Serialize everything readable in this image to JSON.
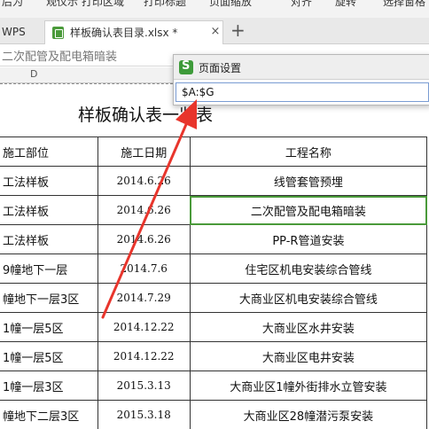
{
  "toolbar": {
    "items": [
      "后为",
      "观仪示",
      "打印区域",
      "打印标题",
      "页面缩放",
      "对齐",
      "旋转",
      "选择窗格"
    ]
  },
  "tabs": {
    "app_tab": "WPS",
    "file_tab": "样板确认表目录.xlsx *",
    "close_glyph": "×",
    "add_glyph": "+"
  },
  "editbar": {
    "content": "二次配管及配电箱暗装"
  },
  "column_header": {
    "visible_column": "D"
  },
  "sheet": {
    "title": "样板确认表一览表",
    "headers": [
      "施工部位",
      "施工日期",
      "工程名称"
    ],
    "rows": [
      [
        "工法样板",
        "2014.6.26",
        "线管套管预埋"
      ],
      [
        "工法样板",
        "2014.6.26",
        "二次配管及配电箱暗装"
      ],
      [
        "工法样板",
        "2014.6.26",
        "PP-R管道安装"
      ],
      [
        "9幢地下一层",
        "2014.7.6",
        "住宅区机电安装综合管线"
      ],
      [
        "幢地下一层3区",
        "2014.7.29",
        "大商业区机电安装综合管线"
      ],
      [
        "1幢一层5区",
        "2014.12.22",
        "大商业区水井安装"
      ],
      [
        "1幢一层5区",
        "2014.12.22",
        "大商业区电井安装"
      ],
      [
        "1幢一层3区",
        "2015.3.13",
        "大商业区1幢外街排水立管安装"
      ],
      [
        "幢地下二层3区",
        "2015.3.18",
        "大商业区28幢潜污泵安装"
      ]
    ]
  },
  "dialog": {
    "title": "页面设置",
    "input_value": "$A:$G"
  },
  "colors": {
    "accent_green": "#4a9a3a",
    "arrow_red": "#e8352c"
  }
}
